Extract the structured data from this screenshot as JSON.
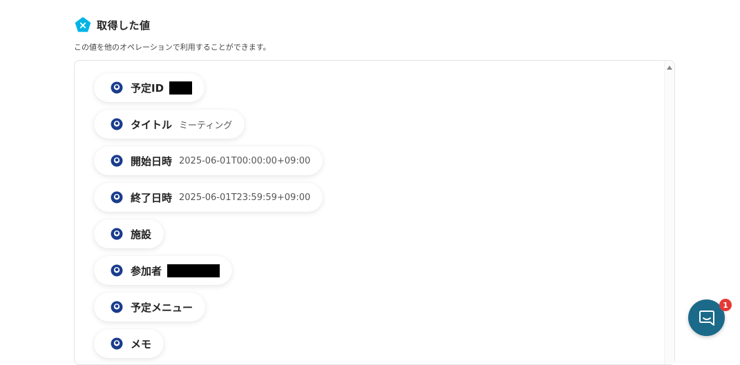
{
  "header": {
    "title": "取得した値",
    "icon": "pentagon-x-icon"
  },
  "description": "この値を他のオペレーションで利用することができます。",
  "items": [
    {
      "label": "予定ID",
      "value": "",
      "redacted": true
    },
    {
      "label": "タイトル",
      "value": "ミーティング",
      "redacted": false
    },
    {
      "label": "開始日時",
      "value": "2025-06-01T00:00:00+09:00",
      "redacted": false
    },
    {
      "label": "終了日時",
      "value": "2025-06-01T23:59:59+09:00",
      "redacted": false
    },
    {
      "label": "施設",
      "value": "",
      "redacted": false
    },
    {
      "label": "参加者",
      "value": "",
      "redacted": true
    },
    {
      "label": "予定メニュー",
      "value": "",
      "redacted": false
    },
    {
      "label": "メモ",
      "value": "",
      "redacted": false
    }
  ],
  "chat": {
    "badge_count": "1",
    "icon": "chat-bubble-icon"
  },
  "colors": {
    "accent": "#00b4e6",
    "chip_icon": "#1a3c8c",
    "chat": "#1c6a8a",
    "badge": "#e53935"
  }
}
